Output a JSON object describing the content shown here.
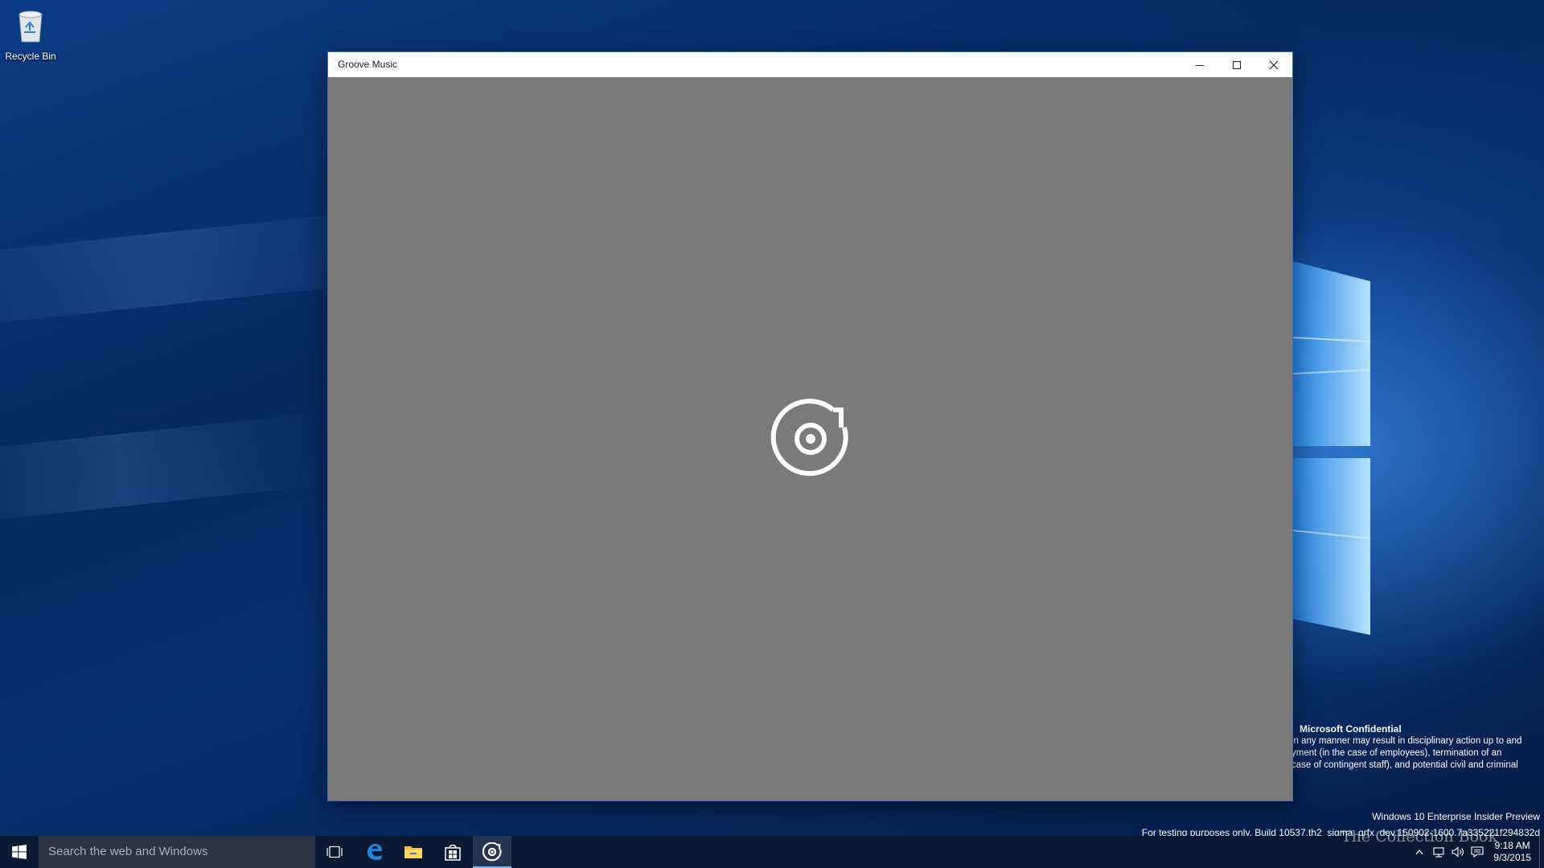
{
  "desktop": {
    "icons": [
      {
        "label": "Recycle Bin",
        "icon": "recycle-bin-icon"
      }
    ],
    "confidential": {
      "title": "Microsoft Confidential",
      "lines": [
        "in any manner may result in disciplinary action up to and",
        "yment (in the case of employees), termination of an",
        "case of contingent staff), and potential civil and criminal"
      ]
    },
    "build_info": {
      "edition": "Windows 10 Enterprise Insider Preview",
      "build": "For testing purposes only. Build 10537.th2_sigma_grfx_dev.150902-1600.7a335221f294832d"
    },
    "watermark": "The Collection Book"
  },
  "window": {
    "title": "Groove Music",
    "controls": {
      "minimize_icon": "minimize-icon",
      "maximize_icon": "maximize-icon",
      "close_icon": "close-icon"
    },
    "splash_icon": "groove-music-logo-icon",
    "splash_background": "#7a7a7a"
  },
  "taskbar": {
    "search_placeholder": "Search the web and Windows",
    "apps": [
      {
        "name": "task-view",
        "icon": "task-view-icon"
      },
      {
        "name": "edge",
        "icon": "edge-icon"
      },
      {
        "name": "file-explorer",
        "icon": "folder-icon"
      },
      {
        "name": "store",
        "icon": "store-icon"
      },
      {
        "name": "groove-music",
        "icon": "groove-music-icon",
        "active": true
      }
    ],
    "clock": {
      "time": "9:18 AM",
      "date": "9/3/2015"
    }
  }
}
